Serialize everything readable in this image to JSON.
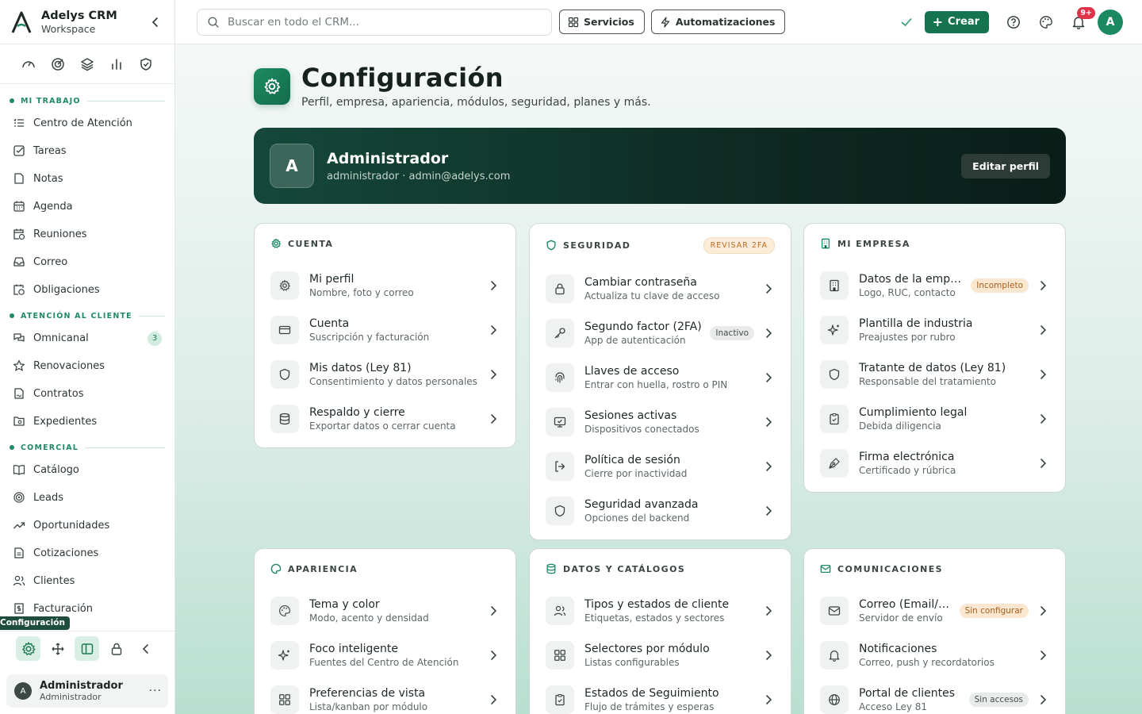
{
  "brand": {
    "name": "Adelys CRM",
    "workspace": "Workspace"
  },
  "sections": [
    {
      "label": "MI TRABAJO",
      "items": [
        {
          "label": "Centro de Atención",
          "icon": "list-check-icon"
        },
        {
          "label": "Tareas",
          "icon": "checkbox-icon"
        },
        {
          "label": "Notas",
          "icon": "note-icon"
        },
        {
          "label": "Agenda",
          "icon": "calendar-icon"
        },
        {
          "label": "Reuniones",
          "icon": "calendar-clock-icon"
        },
        {
          "label": "Correo",
          "icon": "inbox-icon"
        },
        {
          "label": "Obligaciones",
          "icon": "calendar-alert-icon"
        }
      ]
    },
    {
      "label": "ATENCIÓN AL CLIENTE",
      "items": [
        {
          "label": "Omnicanal",
          "icon": "chat-icon",
          "badge": "3"
        },
        {
          "label": "Renovaciones",
          "icon": "star-icon"
        },
        {
          "label": "Contratos",
          "icon": "file-signature-icon"
        },
        {
          "label": "Expedientes",
          "icon": "folder-search-icon"
        }
      ]
    },
    {
      "label": "COMERCIAL",
      "items": [
        {
          "label": "Catálogo",
          "icon": "book-icon"
        },
        {
          "label": "Leads",
          "icon": "target-icon"
        },
        {
          "label": "Oportunidades",
          "icon": "trending-up-icon"
        },
        {
          "label": "Cotizaciones",
          "icon": "file-text-icon"
        },
        {
          "label": "Clientes",
          "icon": "users-icon"
        },
        {
          "label": "Facturación",
          "icon": "receipt-icon"
        }
      ]
    }
  ],
  "tooltip": "Configuración",
  "user": {
    "initial": "A",
    "name": "Administrador",
    "role": "Administrador",
    "more": "···"
  },
  "topbar": {
    "search_placeholder": "Buscar en todo el CRM...",
    "servicios": "Servicios",
    "automatizaciones": "Automatizaciones",
    "crear": "Crear",
    "notif_badge": "9+",
    "avatar": "A"
  },
  "page": {
    "title": "Configuración",
    "subtitle": "Perfil, empresa, apariencia, módulos, seguridad, planes y más."
  },
  "profile": {
    "initial": "A",
    "name": "Administrador",
    "details": "administrador · admin@adelys.com",
    "edit": "Editar perfil"
  },
  "cards": {
    "cuenta": {
      "title": "CUENTA",
      "rows": [
        {
          "title": "Mi perfil",
          "sub": "Nombre, foto y correo"
        },
        {
          "title": "Cuenta",
          "sub": "Suscripción y facturación"
        },
        {
          "title": "Mis datos (Ley 81)",
          "sub": "Consentimiento y datos personales"
        },
        {
          "title": "Respaldo y cierre",
          "sub": "Exportar datos o cerrar cuenta"
        }
      ]
    },
    "seguridad": {
      "title": "SEGURIDAD",
      "pill": "REVISAR 2FA",
      "rows": [
        {
          "title": "Cambiar contraseña",
          "sub": "Actualiza tu clave de acceso"
        },
        {
          "title": "Segundo factor (2FA)",
          "sub": "App de autenticación",
          "tag": "Inactivo"
        },
        {
          "title": "Llaves de acceso",
          "sub": "Entrar con huella, rostro o PIN"
        },
        {
          "title": "Sesiones activas",
          "sub": "Dispositivos conectados"
        },
        {
          "title": "Política de sesión",
          "sub": "Cierre por inactividad"
        },
        {
          "title": "Seguridad avanzada",
          "sub": "Opciones del backend"
        }
      ]
    },
    "empresa": {
      "title": "MI EMPRESA",
      "rows": [
        {
          "title": "Datos de la empresa",
          "sub": "Logo, RUC, contacto",
          "tag": "Incompleto"
        },
        {
          "title": "Plantilla de industria",
          "sub": "Preajustes por rubro"
        },
        {
          "title": "Tratante de datos (Ley 81)",
          "sub": "Responsable del tratamiento"
        },
        {
          "title": "Cumplimiento legal",
          "sub": "Debida diligencia"
        },
        {
          "title": "Firma electrónica",
          "sub": "Certificado y rúbrica"
        }
      ]
    },
    "apariencia": {
      "title": "APARIENCIA",
      "rows": [
        {
          "title": "Tema y color",
          "sub": "Modo, acento y densidad"
        },
        {
          "title": "Foco inteligente",
          "sub": "Fuentes del Centro de Atención"
        },
        {
          "title": "Preferencias de vista",
          "sub": "Lista/kanban por módulo"
        }
      ]
    },
    "datos": {
      "title": "DATOS Y CATÁLOGOS",
      "rows": [
        {
          "title": "Tipos y estados de cliente",
          "sub": "Etiquetas, estados y sectores"
        },
        {
          "title": "Selectores por módulo",
          "sub": "Listas configurables"
        },
        {
          "title": "Estados de Seguimiento",
          "sub": "Flujo de trámites y esperas"
        }
      ]
    },
    "comunicaciones": {
      "title": "COMUNICACIONES",
      "rows": [
        {
          "title": "Correo (Email/SMTP)",
          "sub": "Servidor de envío",
          "tag": "Sin configurar"
        },
        {
          "title": "Notificaciones",
          "sub": "Correo, push y recordatorios"
        },
        {
          "title": "Portal de clientes",
          "sub": "Acceso Ley 81",
          "tag": "Sin accesos"
        }
      ]
    }
  },
  "colors": {
    "accent": "#15744f",
    "hero_dark": "#0e2a22",
    "warn_pill": "#fbe7cf"
  }
}
